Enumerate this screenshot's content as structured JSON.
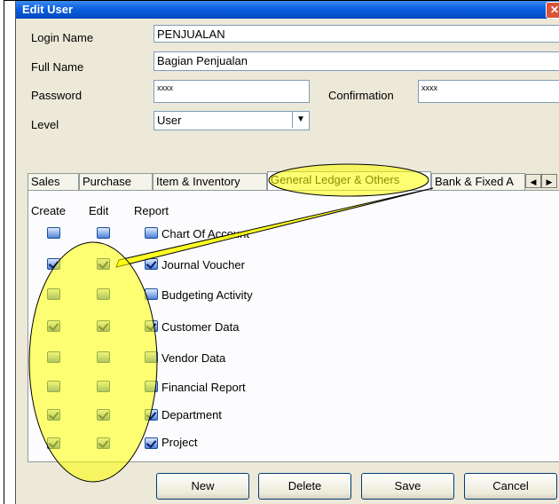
{
  "window": {
    "title": "Edit User",
    "close_glyph": "✕"
  },
  "form": {
    "login_name_label": "Login Name",
    "login_name_value": "PENJUALAN",
    "full_name_label": "Full Name",
    "full_name_value": "Bagian Penjualan",
    "password_label": "Password",
    "password_value": "xxxx",
    "confirmation_label": "Confirmation",
    "confirmation_value": "xxxx",
    "level_label": "Level",
    "level_value": "User"
  },
  "tabs": [
    "Sales",
    "Purchase",
    "Item & Inventory",
    "General Ledger & Others",
    "Bank & Fixed A"
  ],
  "active_tab": "General Ledger & Others",
  "columns": [
    "Create",
    "Edit",
    "Report"
  ],
  "permissions": [
    {
      "label": "Chart Of Account",
      "create": false,
      "edit": false,
      "report": false
    },
    {
      "label": "Journal Voucher",
      "create": true,
      "edit": true,
      "report": true
    },
    {
      "label": "Budgeting Activity",
      "create": false,
      "edit": false,
      "report": false
    },
    {
      "label": "Customer Data",
      "create": true,
      "edit": true,
      "report": true
    },
    {
      "label": "Vendor Data",
      "create": false,
      "edit": false,
      "report": false
    },
    {
      "label": "Financial Report",
      "create": false,
      "edit": false,
      "report": false
    },
    {
      "label": "Department",
      "create": true,
      "edit": true,
      "report": true
    },
    {
      "label": "Project",
      "create": true,
      "edit": true,
      "report": true
    }
  ],
  "buttons": {
    "new": "New",
    "delete": "Delete",
    "save": "Save",
    "cancel": "Cancel"
  },
  "colors": {
    "highlight": "#ffff00",
    "titlebar": "#0a5fe0"
  }
}
